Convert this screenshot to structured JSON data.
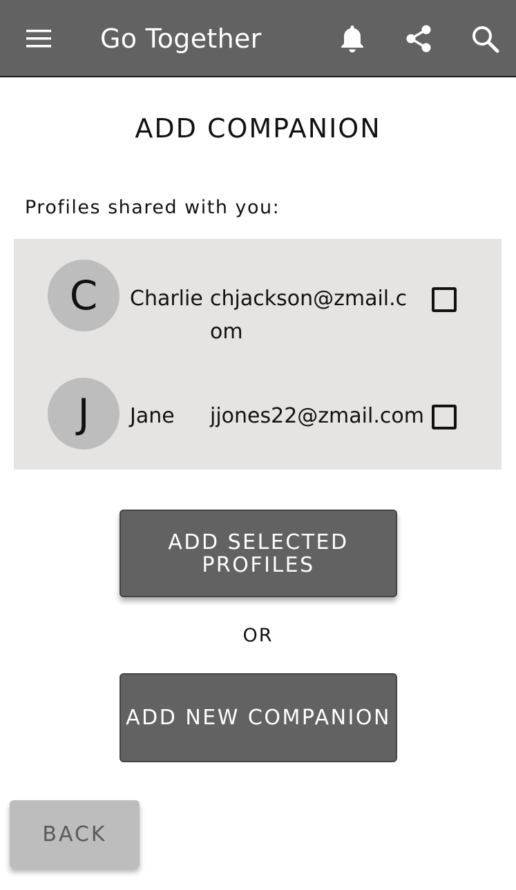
{
  "app_bar": {
    "title": "Go Together",
    "icons": [
      "menu-icon",
      "bell-icon",
      "share-icon",
      "search-icon"
    ],
    "background": "#626262"
  },
  "page_title": "ADD COMPANION",
  "shared_profiles": {
    "label": "Profiles shared with you:",
    "profiles": [
      {
        "initial": "C",
        "name": "Charlie",
        "email": "chjackson@zmail.com",
        "selected": false
      },
      {
        "initial": "J",
        "name": "Jane",
        "email": "jjones22@zmail.com",
        "selected": false
      }
    ]
  },
  "buttons": {
    "add_selected": "ADD SELECTED PROFILES",
    "or_label": "OR",
    "add_new": "ADD NEW COMPANION",
    "back": "BACK"
  },
  "colors": {
    "panel_background": "#e6e3e3",
    "avatar_background": "#bdbdbd",
    "primary_button": "#626262",
    "back_button": "#bdbdbd"
  }
}
